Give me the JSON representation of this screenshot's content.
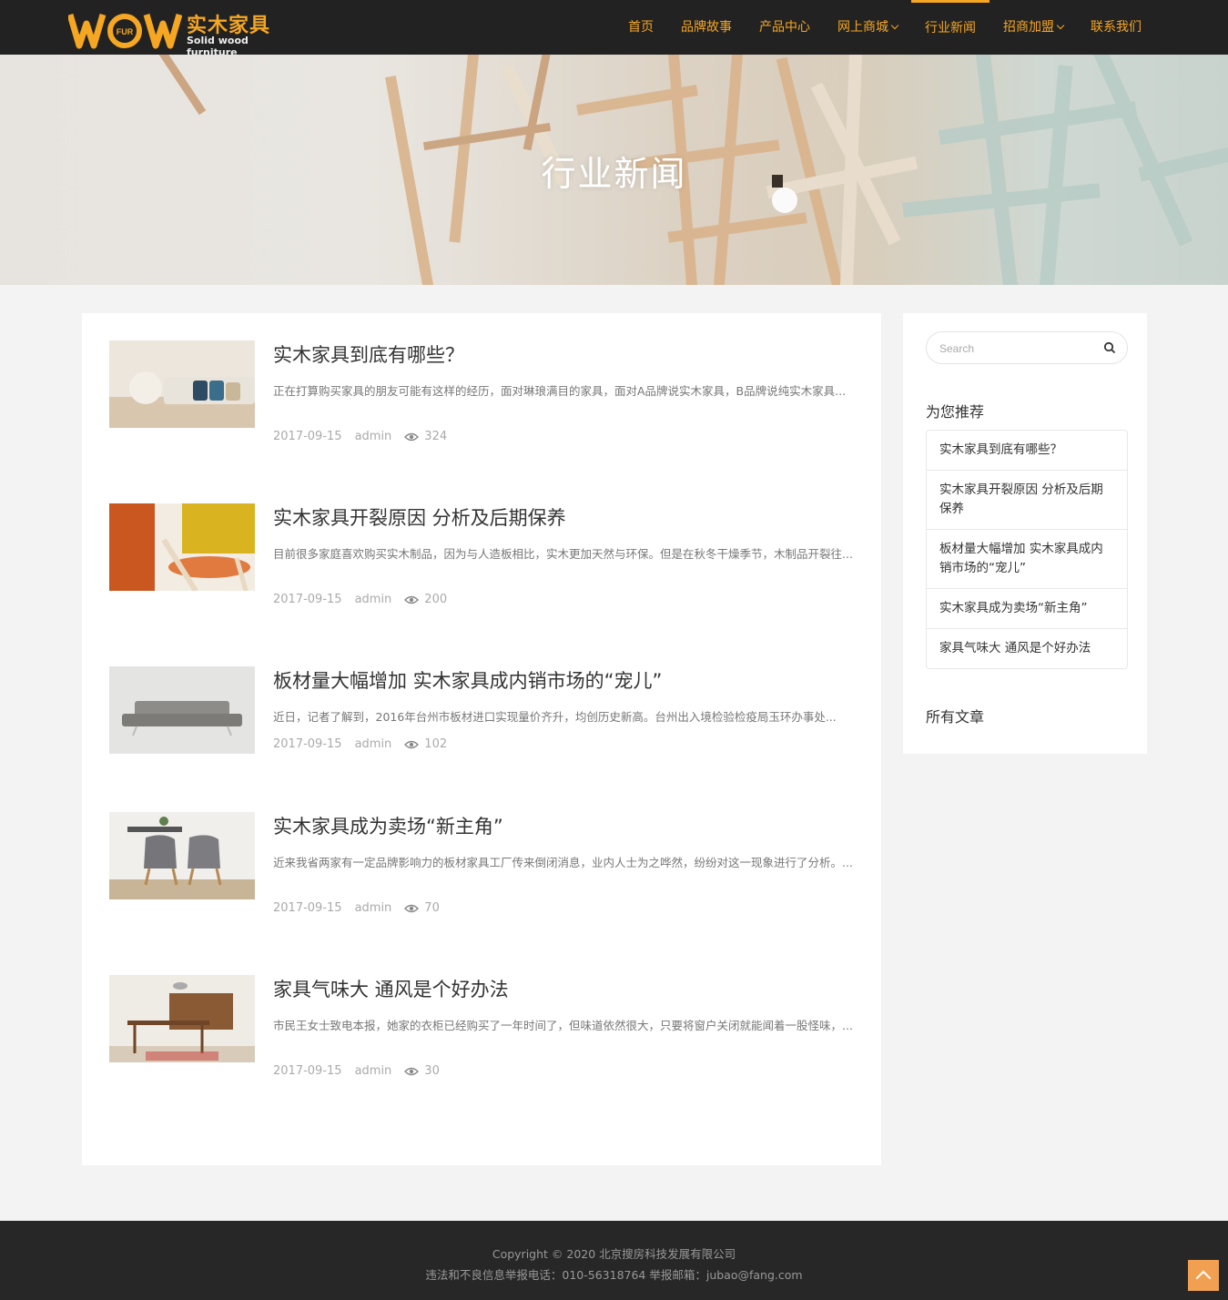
{
  "header": {
    "logo_cn": "实木家具",
    "logo_en": "Solid wood furniture",
    "logo_badge": "FUR",
    "nav": [
      {
        "label": "首页"
      },
      {
        "label": "品牌故事"
      },
      {
        "label": "产品中心"
      },
      {
        "label": "网上商城"
      },
      {
        "label": "行业新闻"
      },
      {
        "label": "招商加盟"
      },
      {
        "label": "联系我们"
      }
    ]
  },
  "banner": {
    "title": "行业新闻"
  },
  "articles": [
    {
      "title": "实木家具到底有哪些？",
      "desc": "正在打算购买家具的朋友可能有这样的经历，面对琳琅满目的家具，面对A品牌说实木家具，B品牌说纯实木家具...",
      "date": "2017-09-15",
      "author": "admin",
      "views": "324"
    },
    {
      "title": "实木家具开裂原因 分析及后期保养",
      "desc": "目前很多家庭喜欢购买实木制品，因为与人造板相比，实木更加天然与环保。但是在秋冬干燥季节，木制品开裂往...",
      "date": "2017-09-15",
      "author": "admin",
      "views": "200"
    },
    {
      "title": "板材量大幅增加 实木家具成内销市场的“宠儿”",
      "desc": "近日，记者了解到，2016年台州市板材进口实现量价齐升，均创历史新高。台州出入境检验检疫局玉环办事处...",
      "date": "2017-09-15",
      "author": "admin",
      "views": "102"
    },
    {
      "title": "实木家具成为卖场“新主角”",
      "desc": "近来我省两家有一定品牌影响力的板材家具工厂传来倒闭消息，业内人士为之哗然，纷纷对这一现象进行了分析。...",
      "date": "2017-09-15",
      "author": "admin",
      "views": "70"
    },
    {
      "title": "家具气味大 通风是个好办法",
      "desc": "市民王女士致电本报，她家的衣柜已经购买了一年时间了，但味道依然很大，只要将窗户关闭就能闻着一股怪味，...",
      "date": "2017-09-15",
      "author": "admin",
      "views": "30"
    }
  ],
  "sidebar": {
    "search_placeholder": "Search",
    "rec_heading": "为您推荐",
    "rec_items": [
      "实木家具到底有哪些？",
      "实木家具开裂原因 分析及后期保养",
      "板材量大幅增加 实木家具成内销市场的“宠儿”",
      "实木家具成为卖场“新主角”",
      "家具气味大 通风是个好办法"
    ],
    "all_heading": "所有文章"
  },
  "footer": {
    "copyright": "Copyright © 2020 北京搜房科技发展有限公司",
    "report": "违法和不良信息举报电话：010-56318764 举报邮箱：jubao@fang.com"
  },
  "colors": {
    "accent": "#f5a623",
    "nav_bg": "#222222",
    "footer_bg": "#272727"
  }
}
